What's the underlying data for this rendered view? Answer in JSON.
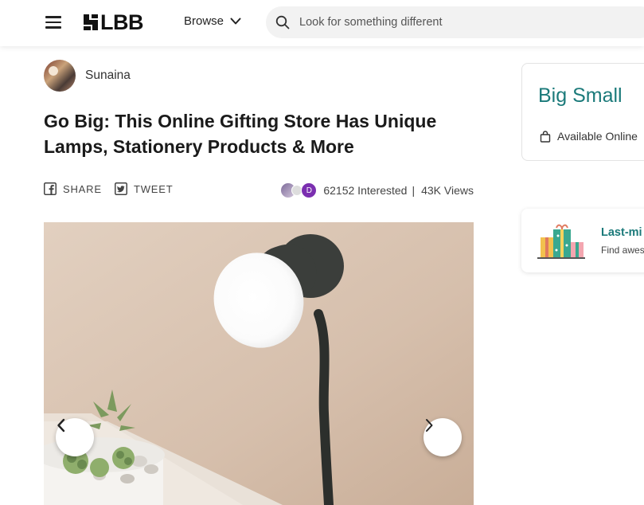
{
  "header": {
    "logo_text": "LBB",
    "browse_label": "Browse",
    "search_placeholder": "Look for something different"
  },
  "author": {
    "name": "Sunaina"
  },
  "article": {
    "title": "Go Big: This Online Gifting Store Has Unique Lamps, Stationery Products & More"
  },
  "share": {
    "share_label": "SHARE",
    "tweet_label": "TWEET",
    "avatar_initial": "D",
    "interested_text": "62152 Interested",
    "separator": "|",
    "views_text": "43K  Views"
  },
  "sidebar": {
    "place_name": "Big Small",
    "availability": "Available Online",
    "promo_title": "Last-mi",
    "promo_subtitle": "Find awes"
  },
  "colors": {
    "accent_teal": "#1b7a7a",
    "avatar_purple": "#7b2fb0",
    "search_bg": "#f2f2f2"
  }
}
